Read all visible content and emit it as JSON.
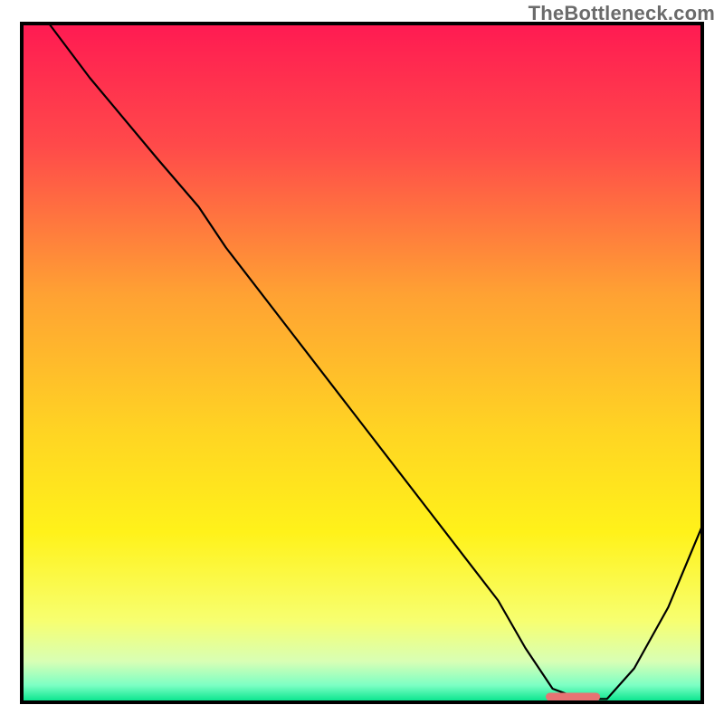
{
  "watermark": "TheBottleneck.com",
  "chart_data": {
    "type": "line",
    "title": "",
    "xlabel": "",
    "ylabel": "",
    "xlim": [
      0,
      100
    ],
    "ylim": [
      0,
      100
    ],
    "border_color": "#000000",
    "gradient_stops": [
      {
        "offset": 0.0,
        "color": "#ff1a52"
      },
      {
        "offset": 0.18,
        "color": "#ff4a4a"
      },
      {
        "offset": 0.4,
        "color": "#ffa233"
      },
      {
        "offset": 0.6,
        "color": "#ffd423"
      },
      {
        "offset": 0.75,
        "color": "#fff21a"
      },
      {
        "offset": 0.88,
        "color": "#f7ff70"
      },
      {
        "offset": 0.94,
        "color": "#d8ffb5"
      },
      {
        "offset": 0.975,
        "color": "#7cffc4"
      },
      {
        "offset": 1.0,
        "color": "#00e38a"
      }
    ],
    "series": [
      {
        "name": "bottleneck-curve",
        "stroke": "#000000",
        "stroke_width": 2.2,
        "x": [
          4,
          10,
          20,
          26,
          30,
          40,
          50,
          60,
          70,
          74,
          78,
          82,
          86,
          90,
          95,
          100
        ],
        "values": [
          100,
          92,
          80,
          73,
          67,
          54,
          41,
          28,
          15,
          8,
          2,
          0.5,
          0.5,
          5,
          14,
          26
        ]
      }
    ],
    "marker": {
      "name": "optimal-marker",
      "color": "#e77373",
      "x": [
        77,
        85
      ],
      "y": 0.8,
      "height": 1.2,
      "radius": 0.6
    }
  }
}
